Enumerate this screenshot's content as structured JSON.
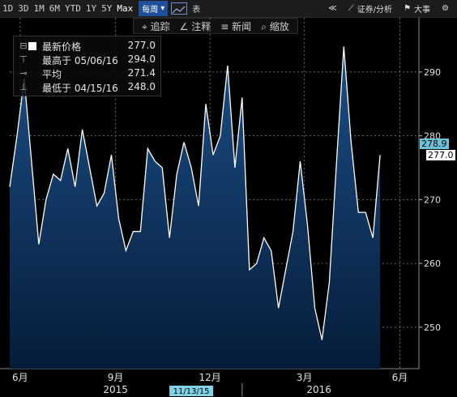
{
  "toolbar": {
    "ranges": [
      "1D",
      "3D",
      "1M",
      "6M",
      "YTD",
      "1Y",
      "5Y",
      "Max"
    ],
    "frequency": "每周",
    "table_label": "表",
    "tools": {
      "compare": "证券/分析",
      "events": "大事"
    }
  },
  "subbar": {
    "track": "追踪",
    "annotate": "注释",
    "news": "新闻",
    "zoom": "缩放"
  },
  "legend": {
    "last": {
      "name": "最新价格",
      "value": "277.0"
    },
    "high": {
      "name": "最高于 05/06/16",
      "value": "294.0"
    },
    "avg": {
      "name": "平均",
      "value": "271.4"
    },
    "low": {
      "name": "最低于 04/15/16",
      "value": "248.0"
    }
  },
  "price_tags": {
    "prev": "278.9",
    "last": "277.0"
  },
  "colors": {
    "background": "#000000",
    "area_top": "#1b4f86",
    "area_bottom": "#061c3a",
    "line": "#ffffff",
    "tag_prev": "#6cc2d8",
    "tag_last": "#ffffff"
  },
  "chart_data": {
    "type": "area",
    "title": "",
    "xlabel": "",
    "ylabel": "",
    "ylim": [
      243.5,
      298.5
    ],
    "yticks": [
      250,
      260,
      270,
      280,
      290
    ],
    "grid": true,
    "legend_position": "top-left",
    "x_tick_labels": [
      "6月",
      "9月",
      "12月",
      "3月",
      "6月"
    ],
    "x_year_labels": [
      "2015",
      "2016"
    ],
    "x_cursor_label": "11/13/15",
    "x": [
      "2015-05-22",
      "2015-05-29",
      "2015-06-05",
      "2015-06-12",
      "2015-06-19",
      "2015-06-26",
      "2015-07-03",
      "2015-07-10",
      "2015-07-17",
      "2015-07-24",
      "2015-07-31",
      "2015-08-07",
      "2015-08-14",
      "2015-08-21",
      "2015-08-28",
      "2015-09-04",
      "2015-09-11",
      "2015-09-18",
      "2015-09-25",
      "2015-10-02",
      "2015-10-09",
      "2015-10-16",
      "2015-10-23",
      "2015-10-30",
      "2015-11-06",
      "2015-11-13",
      "2015-11-20",
      "2015-11-27",
      "2015-12-04",
      "2015-12-11",
      "2015-12-18",
      "2015-12-25",
      "2016-01-01",
      "2016-01-08",
      "2016-01-15",
      "2016-01-22",
      "2016-01-29",
      "2016-02-05",
      "2016-02-12",
      "2016-02-19",
      "2016-02-26",
      "2016-03-04",
      "2016-03-11",
      "2016-03-18",
      "2016-03-25",
      "2016-04-01",
      "2016-04-08",
      "2016-04-15",
      "2016-04-22",
      "2016-04-29",
      "2016-05-06",
      "2016-05-13",
      "2016-05-20",
      "2016-05-27",
      "2016-06-03",
      "2016-06-10"
    ],
    "series": [
      {
        "values": [
          272,
          280,
          289,
          276,
          263,
          270,
          274,
          273,
          278,
          272,
          281,
          275,
          269,
          271,
          277,
          267,
          262,
          265,
          265,
          278,
          276,
          275,
          264,
          274,
          279,
          275,
          269,
          285,
          277,
          280,
          291,
          275,
          286,
          259,
          260,
          264,
          262,
          253,
          259,
          265,
          276,
          266,
          253,
          248,
          257,
          276,
          294,
          279,
          268,
          268,
          264,
          277
        ]
      }
    ]
  }
}
